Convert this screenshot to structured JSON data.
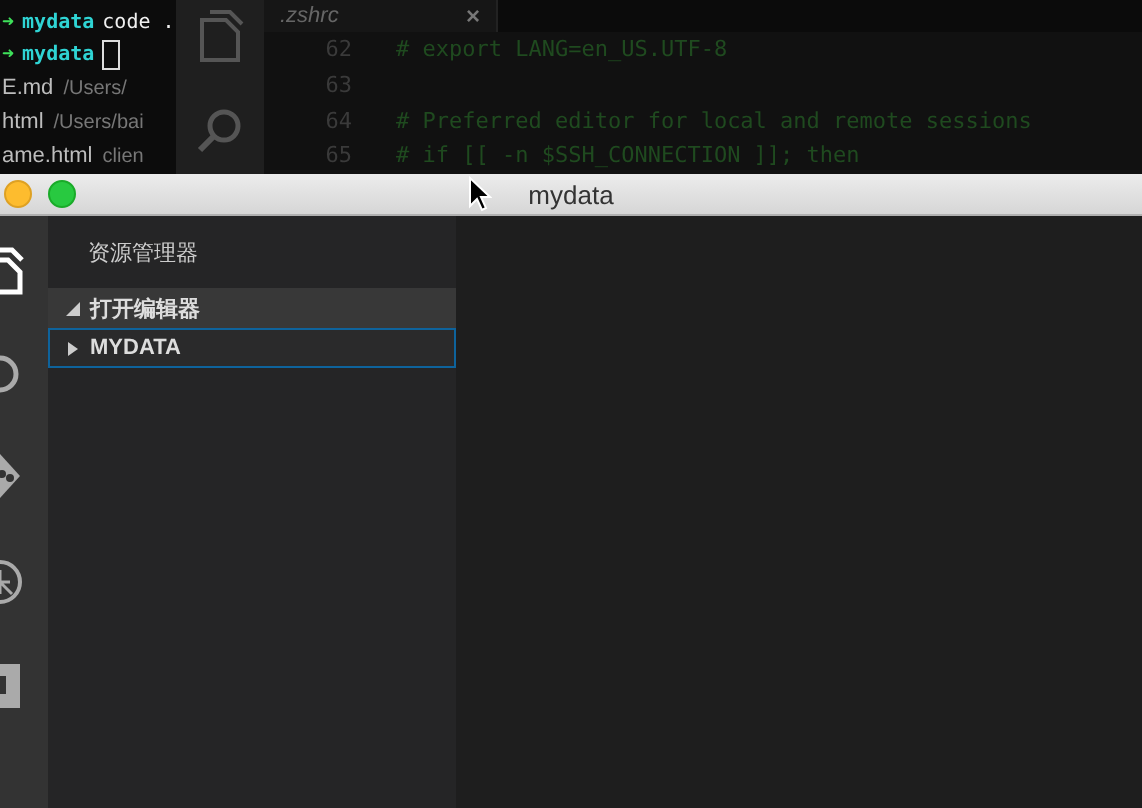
{
  "terminal": {
    "lines": [
      {
        "kind": "command",
        "arrow": "➜",
        "dir": "mydata",
        "command": "code ."
      },
      {
        "kind": "cursor",
        "arrow": "➜",
        "dir": "mydata"
      }
    ],
    "files": [
      {
        "name": "E.md",
        "path": "/Users/"
      },
      {
        "name": "html",
        "path": "/Users/bai"
      },
      {
        "name": "ame.html",
        "path": "clien"
      }
    ]
  },
  "back_window": {
    "tab": {
      "label": ".zshrc",
      "close": "×"
    },
    "lines": [
      {
        "number": "62",
        "code": "# export LANG=en_US.UTF-8"
      },
      {
        "number": "63"
      },
      {
        "number": "64",
        "code": "# Preferred editor for local and remote sessions"
      },
      {
        "number": "65",
        "code": "# if [[ -n $SSH_CONNECTION ]]; then"
      }
    ]
  },
  "window": {
    "title": "mydata"
  },
  "sidebar": {
    "title": "资源管理器",
    "sections": [
      {
        "label": "打开编辑器",
        "expanded": true,
        "focused": false
      },
      {
        "label": "MYDATA",
        "expanded": false,
        "focused": true
      }
    ]
  }
}
